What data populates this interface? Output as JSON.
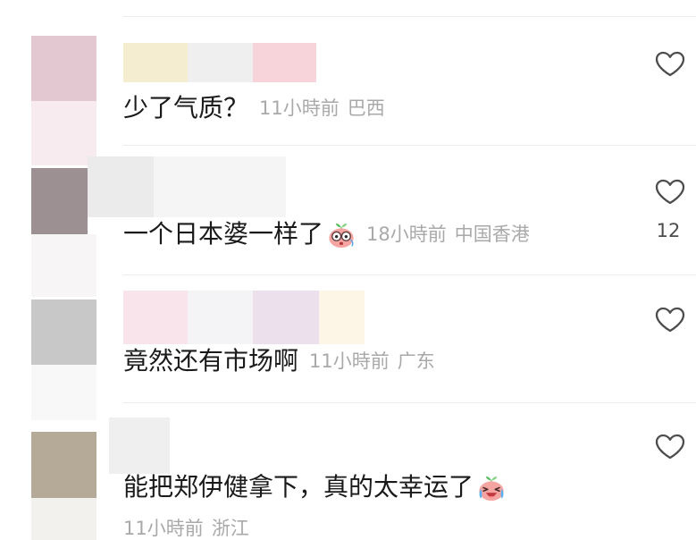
{
  "comments": [
    {
      "text": "少了气质？",
      "time": "11小時前",
      "location": "巴西",
      "like_icon": "heart-outline-icon"
    },
    {
      "text": "一个日本婆一样了",
      "emoji_icon": "emoji-shocked-icon",
      "time": "18小時前",
      "location": "中国香港",
      "like_icon": "heart-outline-icon",
      "like_count": 12
    },
    {
      "text": "竟然还有市场啊",
      "time": "11小時前",
      "location": "广东",
      "like_icon": "heart-outline-icon"
    },
    {
      "text": "能把郑伊健拿下，真的太幸运了",
      "emoji_icon": "emoji-cry-laugh-icon",
      "time": "11小時前",
      "location": "浙江",
      "like_icon": "heart-outline-icon"
    }
  ],
  "colors": {
    "text_primary": "#1a1a1a",
    "text_meta": "#a9a9a9",
    "icon": "#4d4d4d",
    "divider": "#ececec",
    "background": "#ffffff"
  }
}
